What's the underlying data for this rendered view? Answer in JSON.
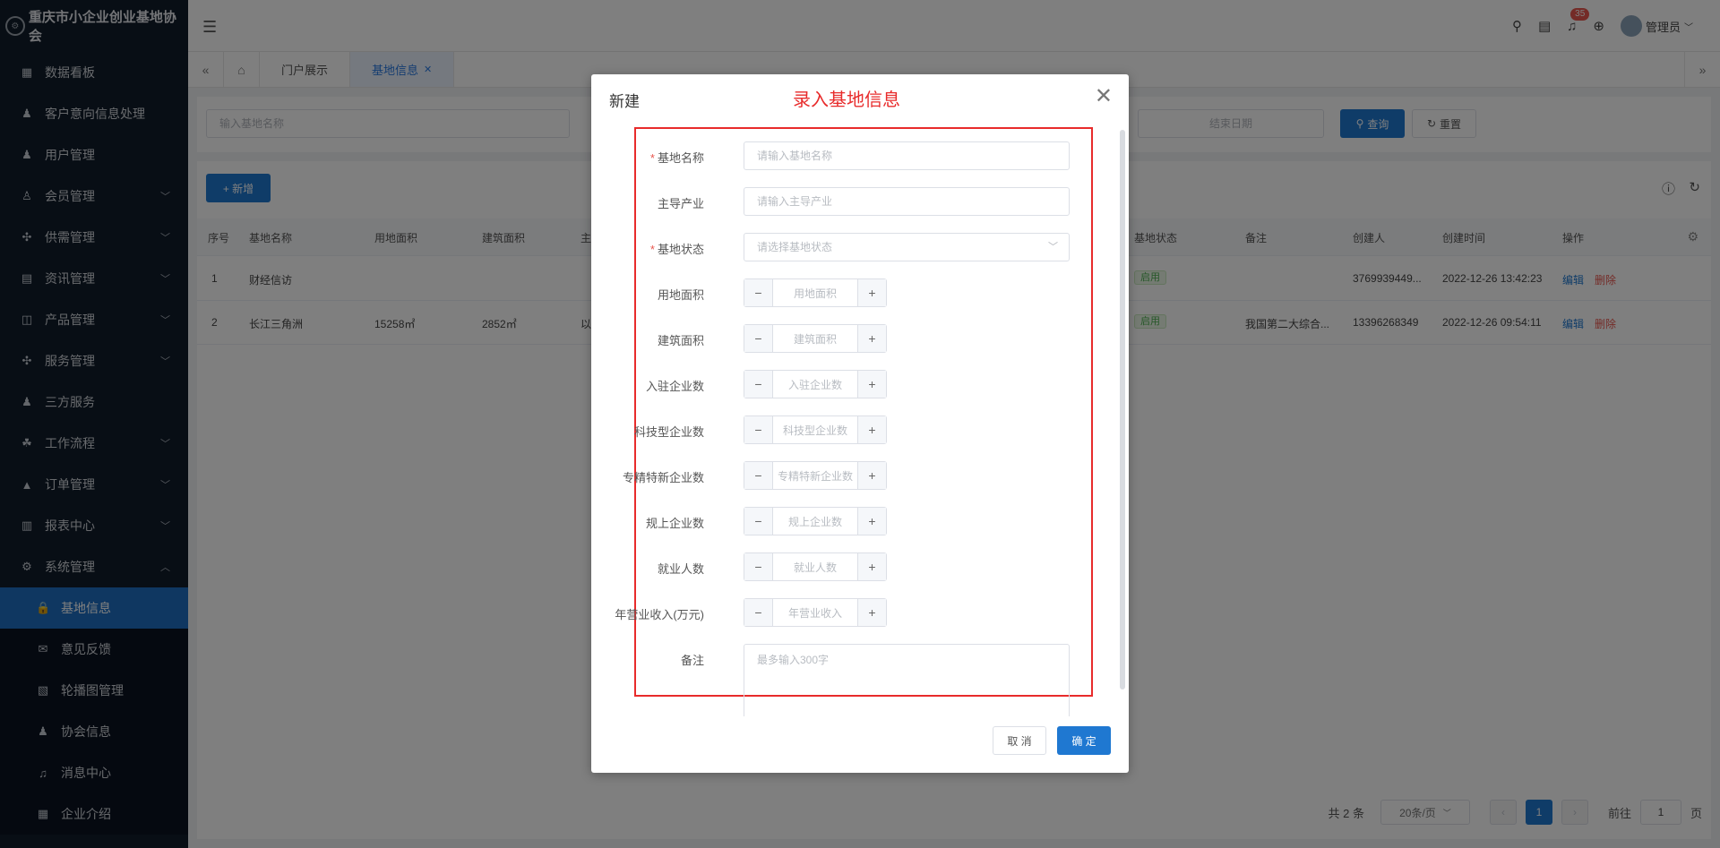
{
  "brand": {
    "name": "重庆市小企业创业基地协会"
  },
  "sidebar": {
    "items": [
      {
        "label": "数据看板",
        "icon": "dashboard-icon",
        "chev": ""
      },
      {
        "label": "客户意向信息处理",
        "icon": "user-icon",
        "chev": ""
      },
      {
        "label": "用户管理",
        "icon": "user-icon",
        "chev": ""
      },
      {
        "label": "会员管理",
        "icon": "member-icon",
        "chev": "﹀"
      },
      {
        "label": "供需管理",
        "icon": "grid-icon",
        "chev": "﹀"
      },
      {
        "label": "资讯管理",
        "icon": "document-icon",
        "chev": "﹀"
      },
      {
        "label": "产品管理",
        "icon": "product-icon",
        "chev": "﹀"
      },
      {
        "label": "服务管理",
        "icon": "grid-icon",
        "chev": "﹀"
      },
      {
        "label": "三方服务",
        "icon": "user-icon",
        "chev": ""
      },
      {
        "label": "工作流程",
        "icon": "flow-icon",
        "chev": "﹀"
      },
      {
        "label": "订单管理",
        "icon": "order-icon",
        "chev": "﹀"
      },
      {
        "label": "报表中心",
        "icon": "report-icon",
        "chev": "﹀"
      },
      {
        "label": "系统管理",
        "icon": "gear-icon",
        "chev": "︿"
      }
    ],
    "subitems": [
      {
        "label": "基地信息",
        "icon": "lock-icon"
      },
      {
        "label": "意见反馈",
        "icon": "mail-icon"
      },
      {
        "label": "轮播图管理",
        "icon": "map-icon"
      },
      {
        "label": "协会信息",
        "icon": "user-icon"
      },
      {
        "label": "消息中心",
        "icon": "bell-icon"
      },
      {
        "label": "企业介绍",
        "icon": "table-icon"
      }
    ]
  },
  "header": {
    "badge": "35",
    "user": "管理员"
  },
  "tabs": {
    "portal": "门户展示",
    "base": "基地信息"
  },
  "search": {
    "name_placeholder": "输入基地名称",
    "end_date": "结束日期",
    "query": "查询",
    "reset": "重置"
  },
  "toolbar": {
    "add": "+ 新增"
  },
  "table": {
    "columns": [
      "序号",
      "基地名称",
      "用地面积",
      "建筑面积",
      "主",
      "基地状态",
      "备注",
      "创建人",
      "创建时间",
      "操作"
    ],
    "rows": [
      {
        "idx": "1",
        "name": "财经信访",
        "land": "",
        "build": "",
        "main": "",
        "status": "启用",
        "remark": "",
        "creator": "3769939449...",
        "time": "2022-12-26 13:42:23",
        "edit": "编辑",
        "del": "删除"
      },
      {
        "idx": "2",
        "name": "长江三角洲",
        "land": "15258㎡",
        "build": "2852㎡",
        "main": "以",
        "status": "启用",
        "remark": "我国第二大综合...",
        "creator": "13396268349",
        "time": "2022-12-26 09:54:11",
        "edit": "编辑",
        "del": "删除"
      }
    ]
  },
  "pager": {
    "total": "共 2 条",
    "size": "20条/页",
    "current": "1",
    "goto": "前往",
    "goto_value": "1",
    "page_unit": "页"
  },
  "dialog": {
    "title": "新建",
    "note": "录入基地信息",
    "fields": [
      {
        "label": "基地名称",
        "required": "*",
        "placeholder": "请输入基地名称"
      },
      {
        "label": "主导产业",
        "required": "",
        "placeholder": "请输入主导产业"
      },
      {
        "label": "基地状态",
        "required": "*",
        "placeholder": "请选择基地状态"
      },
      {
        "label": "用地面积",
        "required": "",
        "placeholder": "用地面积"
      },
      {
        "label": "建筑面积",
        "required": "",
        "placeholder": "建筑面积"
      },
      {
        "label": "入驻企业数",
        "required": "",
        "placeholder": "入驻企业数"
      },
      {
        "label": "科技型企业数",
        "required": "",
        "placeholder": "科技型企业数"
      },
      {
        "label": "专精特新企业数",
        "required": "",
        "placeholder": "专精特新企业数"
      },
      {
        "label": "规上企业数",
        "required": "",
        "placeholder": "规上企业数"
      },
      {
        "label": "就业人数",
        "required": "",
        "placeholder": "就业人数"
      },
      {
        "label": "年营业收入(万元)",
        "required": "",
        "placeholder": "年营业收入"
      },
      {
        "label": "备注",
        "required": "",
        "placeholder": "最多输入300字"
      }
    ],
    "cancel": "取 消",
    "confirm": "确 定"
  }
}
